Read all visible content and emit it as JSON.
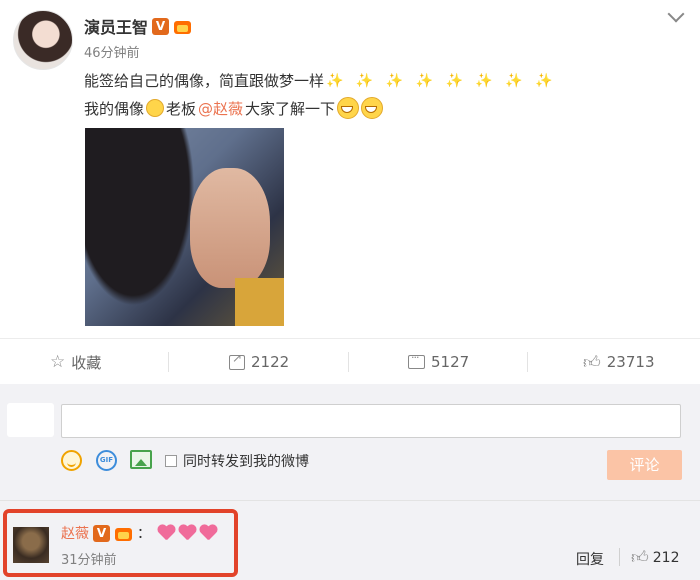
{
  "post": {
    "author": "演员王智",
    "verified_badge": "V",
    "time": "46分钟前",
    "text_line1": "能签给自己的偶像，简直跟做梦一样",
    "sparkles": "✨ ✨ ✨ ✨ ✨ ✨ ✨ ✨",
    "text_line2_a": "我的偶像",
    "text_line2_b": " 老板",
    "mention": "@赵薇",
    "text_line2_c": " 大家了解一下"
  },
  "actions": {
    "favorite_label": "收藏",
    "share_count": "2122",
    "comment_count": "5127",
    "like_count": "23713"
  },
  "composer": {
    "sync_label": "同时转发到我的微博",
    "submit_label": "评论",
    "gif_label": "GIF"
  },
  "reply": {
    "author": "赵薇",
    "verified_badge": "V",
    "colon": "：",
    "time": "31分钟前",
    "reply_label": "回复",
    "like_count": "212"
  },
  "icons": [
    "chevron-down-icon",
    "star-icon",
    "share-icon",
    "comment-icon",
    "like-icon",
    "smile-icon",
    "gif-icon",
    "image-icon",
    "crown-icon",
    "heart-icon"
  ],
  "colors": {
    "accent": "#eb7350",
    "highlight_border": "#e2432a",
    "submit_disabled": "#fbc4a6"
  }
}
